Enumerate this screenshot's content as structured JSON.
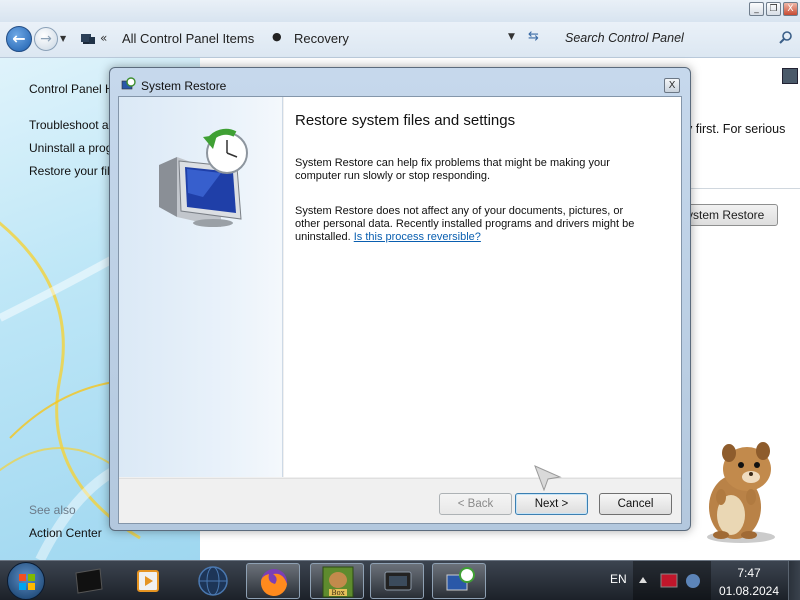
{
  "window": {
    "controls": [
      "_",
      "❐",
      "X"
    ]
  },
  "address_bar": {
    "overflow": "«",
    "breadcrumbs": [
      "All Control Panel Items",
      "Recovery"
    ],
    "separator": "▸",
    "search_placeholder": "Search Control Panel"
  },
  "left_pane": {
    "links": [
      "Control Panel H",
      "Troubleshoot a",
      "Uninstall a prog",
      "Restore your fil"
    ],
    "see_also_label": "See also",
    "see_also_links": [
      "Action Center"
    ]
  },
  "background_page": {
    "text_fragment": "y first. For serious",
    "button_fragment": "ystem Restore"
  },
  "dialog": {
    "title": "System Restore",
    "close": "X",
    "heading": "Restore system files and settings",
    "paragraph1": "System Restore can help fix problems that might be making your computer run slowly or stop responding.",
    "paragraph2_line1": "System Restore does not affect any of your documents, pictures, or",
    "paragraph2_line2": "other personal data. Recently installed programs and drivers might be",
    "paragraph2_line3": "uninstalled.",
    "link": "Is this process reversible?",
    "buttons": {
      "back": "< Back",
      "next": "Next >",
      "cancel": "Cancel"
    },
    "back_enabled": false
  },
  "taskbar": {
    "items": [
      "terminal",
      "media-player",
      "globe",
      "firefox",
      "box-game",
      "display-settings",
      "system-restore"
    ],
    "active_item": "system-restore",
    "language": "EN",
    "time": "7:47",
    "date": "01.08.2024"
  },
  "colors": {
    "link": "#0a5fb0",
    "taskbar": "#1c2129",
    "dialog_frame": "#b3c8de"
  }
}
